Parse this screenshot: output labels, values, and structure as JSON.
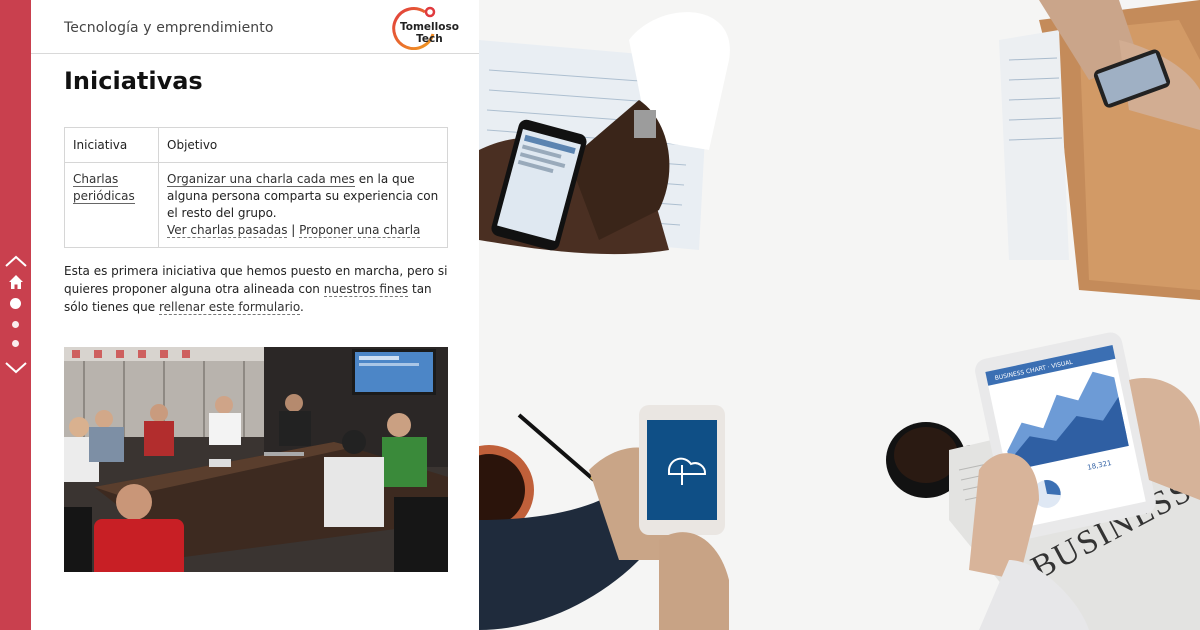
{
  "header": {
    "site_title": "Tecnología y emprendimiento",
    "logo_line1": "Tomelloso",
    "logo_line2": "Tech"
  },
  "main": {
    "title": "Iniciativas",
    "table": {
      "headers": [
        "Iniciativa",
        "Objetivo"
      ],
      "row": {
        "initiative_link": "Charlas periódicas",
        "objective_link": "Organizar una charla cada mes",
        "objective_text": " en la que alguna persona comparta su experiencia con el resto del grupo.",
        "past_talks_link": "Ver charlas pasadas",
        "separator": " | ",
        "propose_link": "Proponer una charla"
      }
    },
    "paragraph": {
      "text1": "Esta es primera iniciativa que hemos puesto en marcha, pero si quieres proponer alguna otra alineada con ",
      "link1": "nuestros fines",
      "text2": " tan sólo tienes que ",
      "link2": "rellenar este formulario",
      "text3": "."
    }
  },
  "colors": {
    "rail": "#c9404e",
    "logo_red": "#e03a3e",
    "logo_orange": "#f29c1f"
  },
  "icons": {
    "nav_up": "chevron-up-icon",
    "nav_home": "home-icon",
    "nav_down": "chevron-down-icon"
  },
  "hero": {
    "tablet_caption": "BUSINESS CHART · VISUAL",
    "tablet_value": "18,321",
    "newspaper_word": "BUSINESS"
  }
}
